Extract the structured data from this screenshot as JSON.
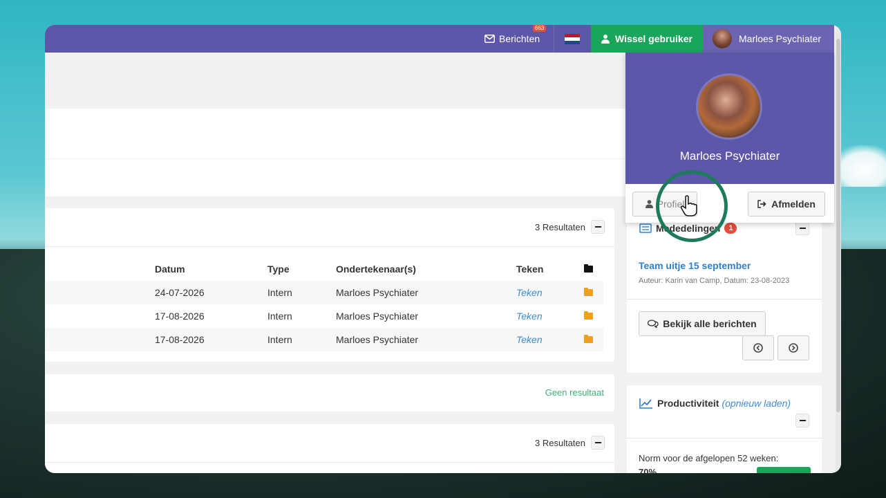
{
  "topbar": {
    "messages_label": "Berichten",
    "messages_badge": "663",
    "switch_user_label": "Wissel gebruiker",
    "user_name": "Marloes Psychiater"
  },
  "documents": {
    "results_label": "3 Resultaten",
    "columns": [
      "Datum",
      "Type",
      "Ondertekenaar(s)",
      "Teken"
    ],
    "rows": [
      {
        "date": "24-07-2026",
        "type": "Intern",
        "signer": "Marloes Psychiater",
        "action": "Teken"
      },
      {
        "date": "17-08-2026",
        "type": "Intern",
        "signer": "Marloes Psychiater",
        "action": "Teken"
      },
      {
        "date": "17-08-2026",
        "type": "Intern",
        "signer": "Marloes Psychiater",
        "action": "Teken"
      }
    ]
  },
  "empty_panel": {
    "label": "Geen resultaat"
  },
  "third_panel": {
    "results_label": "3 Resultaten"
  },
  "user_dropdown": {
    "name": "Marloes Psychiater",
    "profile_label": "Profiel",
    "logout_label": "Afmelden"
  },
  "announcements": {
    "title": "Mededelingen",
    "count": "1",
    "item_title": "Team uitje 15 september",
    "item_meta": "Auteur: Karin van Camp, Datum: 23-08-2023",
    "view_all_label": "Bekijk alle berichten"
  },
  "productivity": {
    "title": "Productiviteit",
    "reload_label": "(opnieuw laden)",
    "norm_text": "Norm voor de afgelopen 52 weken:",
    "norm_value": "70%"
  },
  "colors": {
    "brand": "#5c57a8",
    "success": "#19a65a",
    "link": "#3b8bd0",
    "warning": "#f0a020"
  }
}
